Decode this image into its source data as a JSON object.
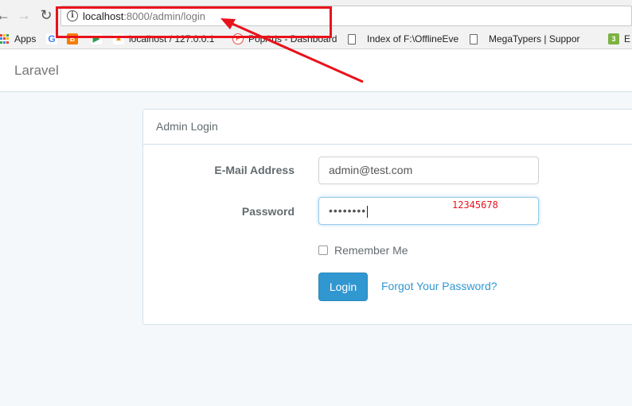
{
  "browser": {
    "url_host": "localhost",
    "url_path": ":8000/admin/login",
    "bookmarks": [
      {
        "label": "Apps"
      },
      {
        "label": ""
      },
      {
        "label": ""
      },
      {
        "label": ""
      },
      {
        "label": "localhost / 127.0.0.1"
      },
      {
        "label": "PopAds - Dashboard"
      },
      {
        "label": "Index of F:\\OfflineEve"
      },
      {
        "label": "MegaTypers | Suppor"
      },
      {
        "label": "E"
      }
    ]
  },
  "navbar": {
    "brand": "Laravel"
  },
  "login": {
    "heading": "Admin Login",
    "email_label": "E-Mail Address",
    "email_value": "admin@test.com",
    "password_label": "Password",
    "password_dots": "••••••••",
    "password_annotation": "12345678",
    "remember_label": "Remember Me",
    "remember_checked": false,
    "submit_label": "Login",
    "forgot_label": "Forgot Your Password?"
  },
  "colors": {
    "annotation": "#e8121b",
    "primary": "#3097d1",
    "text_muted": "#636b6f"
  }
}
